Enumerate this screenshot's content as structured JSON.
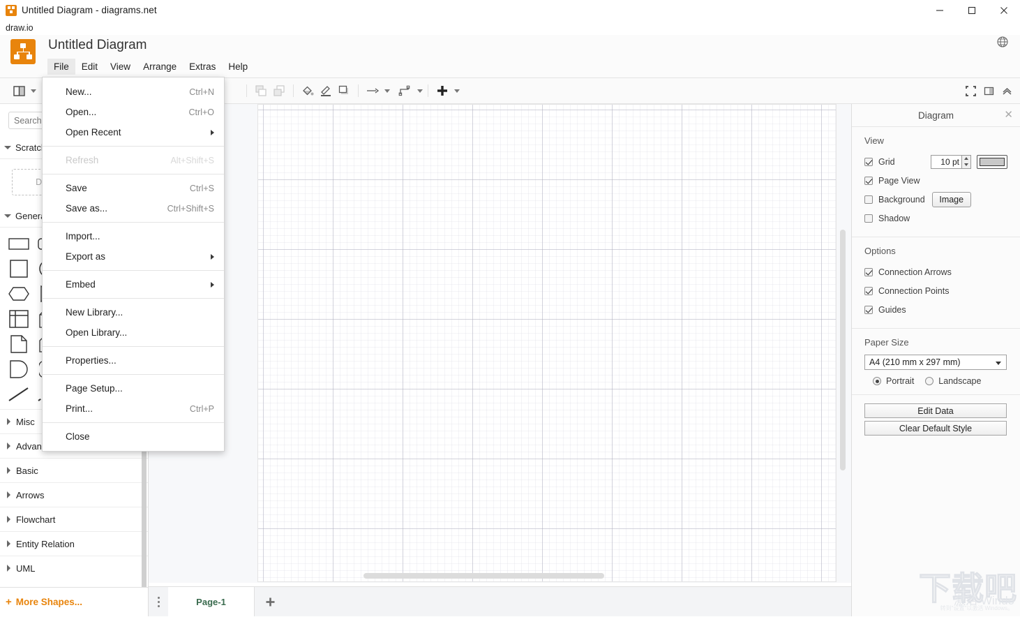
{
  "window": {
    "title": "Untitled Diagram - diagrams.net",
    "app_icon": "drawio-icon",
    "minimize": "minimize-icon",
    "maximize": "maximize-icon",
    "close": "close-icon"
  },
  "subheader": {
    "label": "draw.io"
  },
  "header": {
    "doc_title": "Untitled Diagram",
    "globe_icon": "globe-icon",
    "menus": [
      {
        "label": "File",
        "active": true
      },
      {
        "label": "Edit",
        "active": false
      },
      {
        "label": "View",
        "active": false
      },
      {
        "label": "Arrange",
        "active": false
      },
      {
        "label": "Extras",
        "active": false
      },
      {
        "label": "Help",
        "active": false
      }
    ]
  },
  "toolbar": {
    "view_toggle_icon": "panel-layout-icon",
    "items": [
      {
        "name": "to-front-icon",
        "enabled": false
      },
      {
        "name": "to-back-icon",
        "enabled": false
      },
      {
        "name": "fill-color-icon",
        "enabled": true
      },
      {
        "name": "line-color-icon",
        "enabled": true
      },
      {
        "name": "shadow-icon",
        "enabled": true
      },
      {
        "name": "arrow-style-icon",
        "enabled": true
      },
      {
        "name": "waypoints-icon",
        "enabled": true
      },
      {
        "name": "insert-icon",
        "enabled": true
      }
    ],
    "right_items": [
      {
        "name": "fullscreen-icon"
      },
      {
        "name": "format-panel-toggle-icon"
      },
      {
        "name": "collapse-toolbar-icon"
      }
    ]
  },
  "file_menu": {
    "items": [
      {
        "label": "New...",
        "shortcut": "Ctrl+N",
        "type": "item"
      },
      {
        "label": "Open...",
        "shortcut": "Ctrl+O",
        "type": "item"
      },
      {
        "label": "Open Recent",
        "shortcut": "",
        "type": "submenu"
      },
      {
        "type": "separator"
      },
      {
        "label": "Refresh",
        "shortcut": "Alt+Shift+S",
        "type": "item",
        "disabled": true
      },
      {
        "type": "separator"
      },
      {
        "label": "Save",
        "shortcut": "Ctrl+S",
        "type": "item"
      },
      {
        "label": "Save as...",
        "shortcut": "Ctrl+Shift+S",
        "type": "item"
      },
      {
        "type": "separator"
      },
      {
        "label": "Import...",
        "shortcut": "",
        "type": "item"
      },
      {
        "label": "Export as",
        "shortcut": "",
        "type": "submenu"
      },
      {
        "type": "separator"
      },
      {
        "label": "Embed",
        "shortcut": "",
        "type": "submenu"
      },
      {
        "type": "separator"
      },
      {
        "label": "New Library...",
        "shortcut": "",
        "type": "item"
      },
      {
        "label": "Open Library...",
        "shortcut": "",
        "type": "item"
      },
      {
        "type": "separator"
      },
      {
        "label": "Properties...",
        "shortcut": "",
        "type": "item"
      },
      {
        "type": "separator"
      },
      {
        "label": "Page Setup...",
        "shortcut": "",
        "type": "item"
      },
      {
        "label": "Print...",
        "shortcut": "Ctrl+P",
        "type": "item"
      },
      {
        "type": "separator"
      },
      {
        "label": "Close",
        "shortcut": "",
        "type": "item"
      }
    ]
  },
  "sidebar": {
    "search_placeholder": "Search Shapes",
    "scratchpad": {
      "label": "Scratchpad",
      "dropzone_text": "Drag elements here"
    },
    "general": {
      "label": "General"
    },
    "shapes": [
      "rectangle-shape",
      "rounded-rectangle-shape",
      "text-shape",
      "textbox-shape",
      "ellipse-shape",
      "square-shape",
      "circle-shape",
      "process-shape",
      "diamond-shape",
      "parallelogram-shape",
      "hexagon-shape",
      "triangle-shape",
      "cylinder-shape",
      "cloud-shape",
      "document-shape",
      "internal-storage-shape",
      "cube-shape",
      "step-shape",
      "trapezoid-shape",
      "tape-shape",
      "note-shape",
      "card-shape",
      "callout-shape",
      "actor-shape",
      "or-shape",
      "and-shape",
      "data-storage-shape",
      "list-shape",
      "curve-shape",
      "bidirectional-shape",
      "line-shape",
      "dashed-line-shape",
      "link-shape",
      "arrow-shape",
      "dashed-arrow-shape"
    ],
    "categories": [
      "Misc",
      "Advanced",
      "Basic",
      "Arrows",
      "Flowchart",
      "Entity Relation",
      "UML"
    ],
    "more_shapes": "More Shapes..."
  },
  "format_panel": {
    "title": "Diagram",
    "close_icon": "close-icon",
    "view": {
      "heading": "View",
      "grid": {
        "label": "Grid",
        "checked": true,
        "size_value": "10 pt",
        "color": "#c8c8c8"
      },
      "page_view": {
        "label": "Page View",
        "checked": true
      },
      "background": {
        "label": "Background",
        "checked": false,
        "button": "Image"
      },
      "shadow": {
        "label": "Shadow",
        "checked": false
      }
    },
    "options": {
      "heading": "Options",
      "items": [
        {
          "label": "Connection Arrows",
          "checked": true
        },
        {
          "label": "Connection Points",
          "checked": true
        },
        {
          "label": "Guides",
          "checked": true
        }
      ]
    },
    "paper": {
      "heading": "Paper Size",
      "selected": "A4 (210 mm x 297 mm)",
      "orientation": [
        {
          "label": "Portrait",
          "selected": true
        },
        {
          "label": "Landscape",
          "selected": false
        }
      ]
    },
    "actions": [
      {
        "label": "Edit Data"
      },
      {
        "label": "Clear Default Style"
      }
    ]
  },
  "footer": {
    "menu_icon": "page-menu-icon",
    "pages": [
      {
        "label": "Page-1",
        "active": true
      }
    ],
    "add_page_icon": "plus-icon"
  },
  "watermark": {
    "brand": "下载吧",
    "activate": "Windo",
    "activate_prefix": "激活",
    "sub": "转到\"设置\"以激活 Windows。"
  }
}
